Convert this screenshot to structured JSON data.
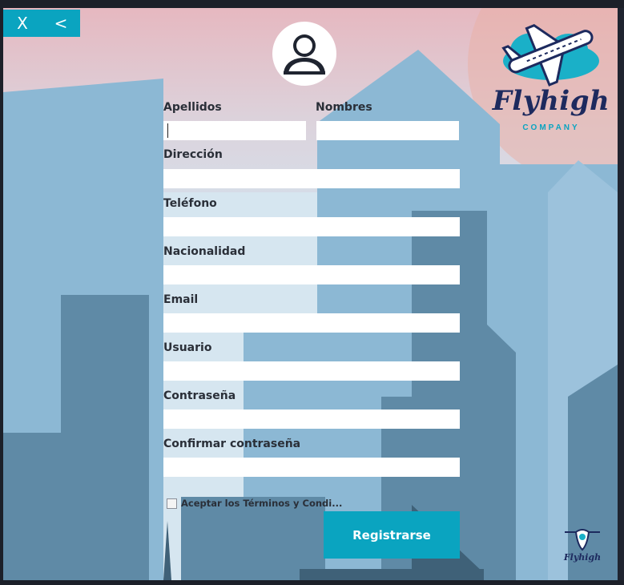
{
  "window_controls": {
    "close": "X",
    "back": "<"
  },
  "logo": {
    "name": "Flyhigh",
    "tagline": "COMPANY"
  },
  "form": {
    "apellidos": {
      "label": "Apellidos",
      "value": ""
    },
    "nombres": {
      "label": "Nombres",
      "value": ""
    },
    "direccion": {
      "label": "Dirección",
      "value": ""
    },
    "telefono": {
      "label": "Teléfono",
      "value": ""
    },
    "nacionalidad": {
      "label": "Nacionalidad",
      "value": ""
    },
    "email": {
      "label": "Email",
      "value": ""
    },
    "usuario": {
      "label": "Usuario",
      "value": ""
    },
    "contrasena": {
      "label": "Contraseña",
      "value": ""
    },
    "confirmar": {
      "label": "Confirmar contraseña",
      "value": ""
    },
    "terms": {
      "label": "Aceptar los Términos y Condi...",
      "checked": false
    },
    "submit_label": "Registrarse"
  },
  "footer_logo": {
    "name": "Flyhigh"
  },
  "colors": {
    "accent": "#0aa4c0",
    "brand_navy": "#1d2a5e",
    "building_light": "#8cb8d4",
    "building_dark": "#5f8aa6"
  }
}
